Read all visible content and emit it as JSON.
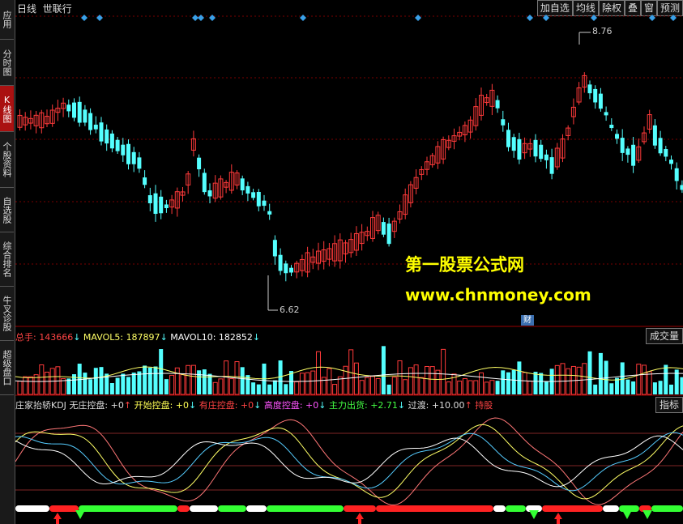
{
  "sidebar": {
    "items": [
      {
        "label": "应用",
        "active": false
      },
      {
        "label": "分时图",
        "active": false
      },
      {
        "label": "K线图",
        "active": true
      },
      {
        "label": "个股资料",
        "active": false
      },
      {
        "label": "自选股",
        "active": false
      },
      {
        "label": "综合排名",
        "active": false
      },
      {
        "label": "牛叉诊股",
        "active": false
      },
      {
        "label": "超级盘口",
        "active": false
      }
    ]
  },
  "header": {
    "period": "日线",
    "stock_name": "世联行",
    "buttons": [
      "加自选",
      "均线",
      "除权",
      "叠",
      "窗",
      "预测"
    ]
  },
  "price_chart": {
    "high_label": "8.76",
    "low_label": "6.62",
    "badge": "财",
    "up_color": "#ff3a3a",
    "down_color": "#54ffff"
  },
  "watermark": {
    "line1": "第一股票公式网",
    "line2": "www.chnmoney.com"
  },
  "volume_panel": {
    "total_label": "总手: ",
    "total_value": "143666",
    "mavol5_label": "MAVOL5: ",
    "mavol5_value": "187897",
    "mavol10_label": "MAVOL10: ",
    "mavol10_value": "182852",
    "right_button": "成交量"
  },
  "kdj_panel": {
    "name": "庄家抬轿KDJ",
    "items": [
      {
        "label": "无庄控盘: ",
        "value": "+0",
        "arrow": "↑",
        "color": "#dddddd"
      },
      {
        "label": "开始控盘: ",
        "value": "+0",
        "arrow": "↓",
        "color": "#ffff55"
      },
      {
        "label": "有庄控盘: ",
        "value": "+0",
        "arrow": "↓",
        "color": "#ff4444"
      },
      {
        "label": "高度控盘: ",
        "value": "+0",
        "arrow": "↓",
        "color": "#ff55ff"
      },
      {
        "label": "主力出货: ",
        "value": "+2.71",
        "arrow": "↓",
        "color": "#44ff44"
      },
      {
        "label": "过渡: ",
        "value": "+10.00",
        "arrow": "↑",
        "color": "#dddddd"
      }
    ],
    "tail": "持股",
    "right_button": "指标"
  }
}
